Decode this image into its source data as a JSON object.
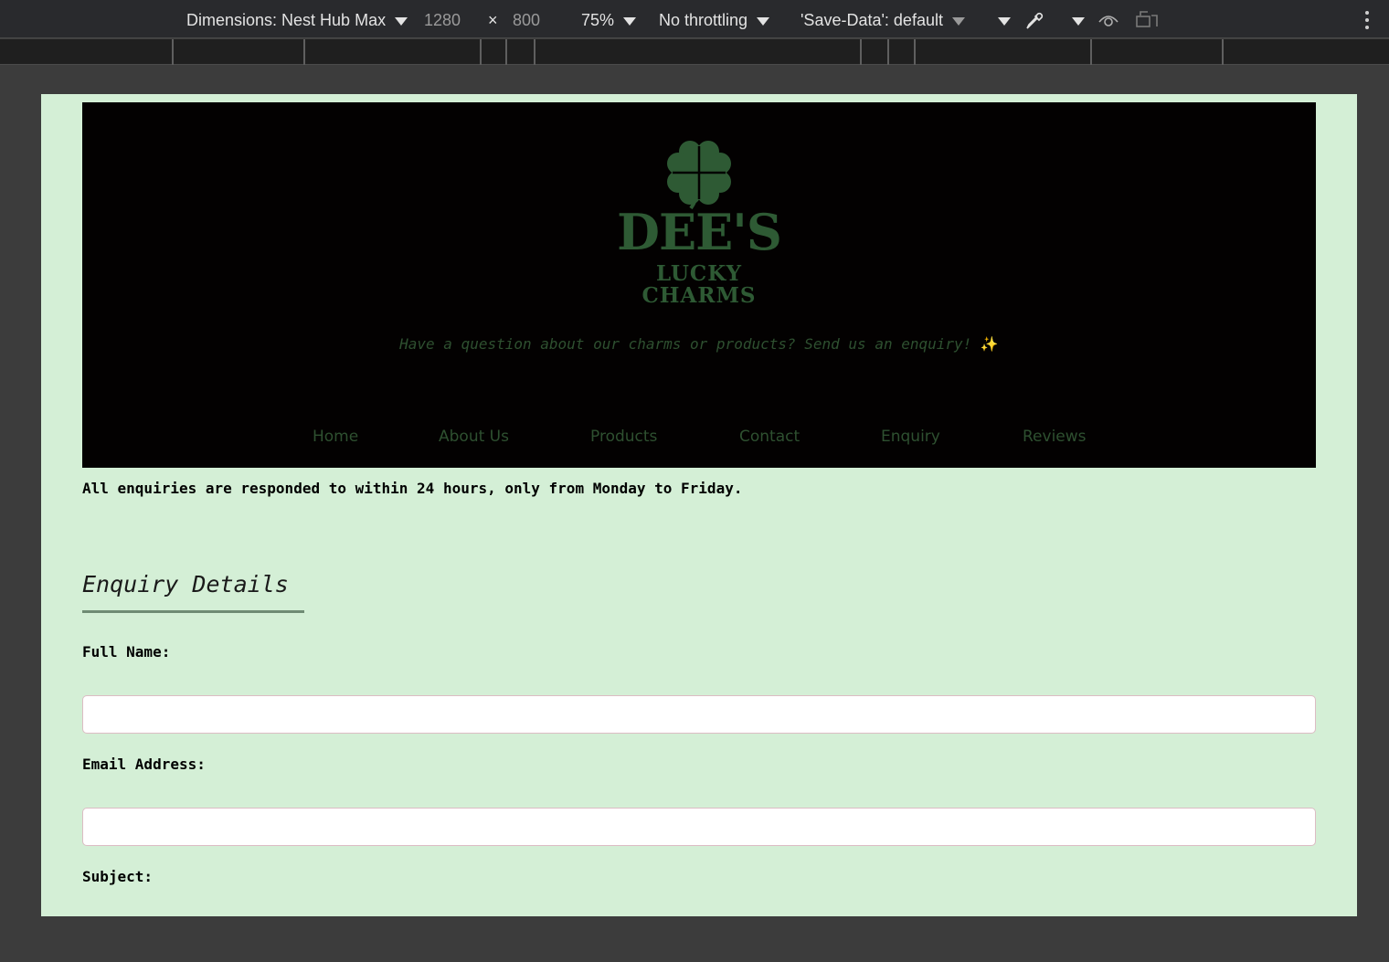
{
  "devtools": {
    "dimensions_label": "Dimensions: Nest Hub Max",
    "width": "1280",
    "times": "×",
    "height": "800",
    "zoom": "75%",
    "throttling": "No throttling",
    "save_data": "'Save-Data': default"
  },
  "brand": {
    "name": "DEE'S",
    "line1": "LUCKY",
    "line2": "CHARMS",
    "logo_color": "#2e5a34"
  },
  "tagline": {
    "text": "Have a question about our charms or products? Send us an enquiry!",
    "emoji": "✨"
  },
  "nav": {
    "items": [
      "Home",
      "About Us",
      "Products",
      "Contact",
      "Enquiry",
      "Reviews"
    ]
  },
  "notice": "All enquiries are responded to within 24 hours, only from Monday to Friday.",
  "form": {
    "heading": "Enquiry Details",
    "full_name_label": "Full Name:",
    "email_label": "Email Address:",
    "subject_label": "Subject:"
  },
  "colors": {
    "page_background": "#d4efd6",
    "hero_background": "#030101",
    "accent_green": "#2e5030"
  }
}
